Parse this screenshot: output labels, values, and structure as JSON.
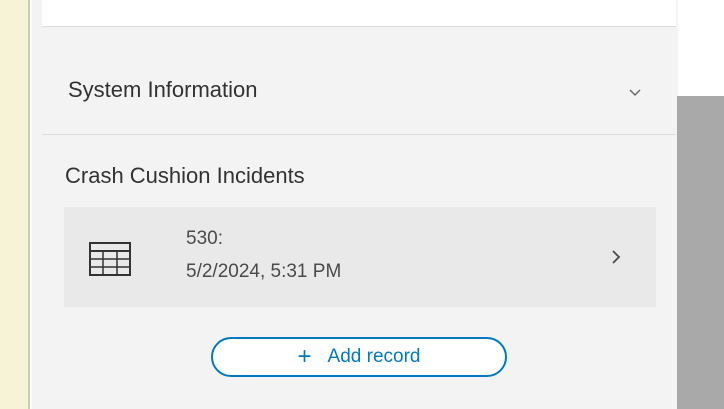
{
  "system_section": {
    "title": "System Information",
    "icon": "chevron-down-icon"
  },
  "related": {
    "title": "Crash Cushion Incidents",
    "records": [
      {
        "id": "530:",
        "date": "5/2/2024, 5:31 PM",
        "icon": "table-icon"
      }
    ],
    "add_button": {
      "plus": "+",
      "label": "Add record"
    }
  },
  "colors": {
    "accent": "#0079c1",
    "panel": "#f3f3f3",
    "card": "#e9e9e9",
    "left_bar": "#f6f3d6",
    "scrollbar_thumb": "#a9a9a9"
  }
}
